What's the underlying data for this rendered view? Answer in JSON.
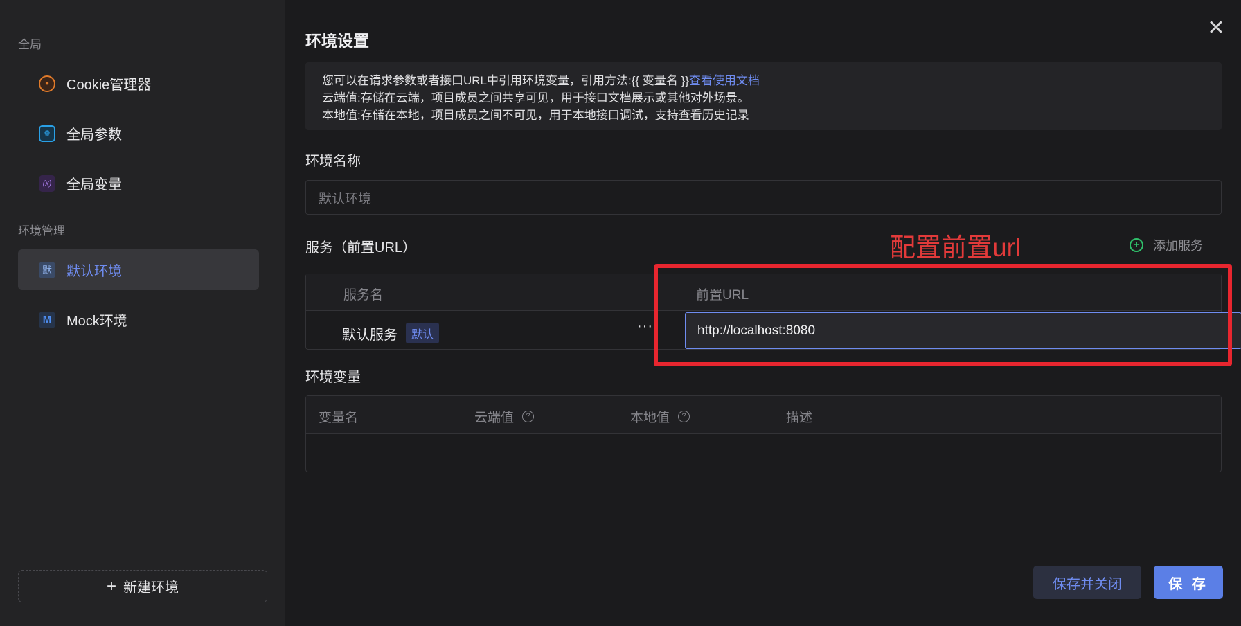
{
  "sidebar": {
    "section_global": "全局",
    "items_global": [
      {
        "label": "Cookie管理器",
        "icon": "cookie-icon"
      },
      {
        "label": "全局参数",
        "icon": "gear-icon"
      },
      {
        "label": "全局变量",
        "icon": "variable-icon"
      }
    ],
    "section_env": "环境管理",
    "items_env": [
      {
        "label": "默认环境",
        "icon_text": "默",
        "active": true
      },
      {
        "label": "Mock环境",
        "icon_text": "M",
        "active": false
      }
    ],
    "new_env_label": "新建环境"
  },
  "main": {
    "title": "环境设置",
    "info": {
      "line1_prefix": "您可以在请求参数或者接口URL中引用环境变量，引用方法:{{ 变量名 }}",
      "line1_link": "查看使用文档",
      "line2": "云端值:存储在云端，项目成员之间共享可见，用于接口文档展示或其他对外场景。",
      "line3": "本地值:存储在本地，项目成员之间不可见，用于本地接口调试，支持查看历史记录"
    },
    "env_name_label": "环境名称",
    "env_name_value": "默认环境",
    "services_label": "服务（前置URL）",
    "add_service_label": "添加服务",
    "annotation": "配置前置url",
    "services_table": {
      "col_name": "服务名",
      "col_url": "前置URL",
      "rows": [
        {
          "name": "默认服务",
          "tag": "默认",
          "url": "http://localhost:8080"
        }
      ]
    },
    "env_vars_label": "环境变量",
    "vars_table": {
      "cols": [
        "变量名",
        "云端值",
        "本地值",
        "描述"
      ]
    },
    "save_close_label": "保存并关闭",
    "save_label": "保 存"
  },
  "colors": {
    "accent": "#6f8cf0",
    "annotation_red": "#e8262f",
    "add_green": "#2fbf6a"
  }
}
